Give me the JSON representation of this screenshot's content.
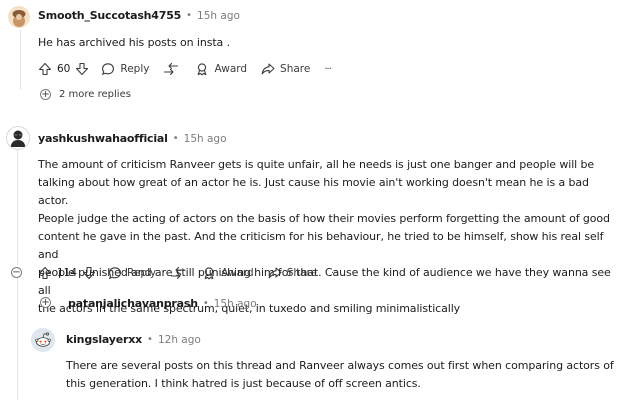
{
  "comments": [
    {
      "username": "Smooth_Succotash4755",
      "time": "15h ago",
      "body": [
        "He has archived his posts on insta ."
      ],
      "votes": "60",
      "actions": {
        "reply": "Reply",
        "award": "Award",
        "share": "Share",
        "more": "···"
      },
      "more_replies": "2 more replies"
    },
    {
      "username": "yashkushwahaofficial",
      "time": "15h ago",
      "body": [
        "The amount of criticism Ranveer gets is quite unfair, all he needs is just one banger and people will be",
        "talking about how great of an actor he is. Just cause his movie ain't working doesn't mean he is a bad actor.",
        "People judge the acting of actors on the basis of how their movies perform forgetting the amount of good",
        "content he gave in the past. And the criticism for his behaviour, he tried to be himself, show his real self and",
        "people punished and are still punishing him for that. Cause the kind of audience we have they wanna see all",
        "the actors in the same spectrum, quiet, in tuxedo and smiling minimalistically"
      ],
      "votes": "114",
      "actions": {
        "reply": "Reply",
        "award": "Award",
        "share": "Share",
        "more": "···"
      }
    },
    {
      "username": "patanjalichavanprash",
      "time": "15h ago"
    },
    {
      "username": "kingslayerxx",
      "time": "12h ago",
      "body": [
        "There are several posts on this thread and Ranveer always comes out first when comparing actors of",
        "this generation. I think hatred is just because of off screen antics."
      ]
    }
  ],
  "icons": {
    "upvote": "upvote-icon",
    "downvote": "downvote-icon",
    "reply": "comment-bubble-icon",
    "award": "award-icon",
    "share": "share-icon",
    "more": "ellipsis-icon",
    "expand": "plus-circle-icon",
    "collapse": "minus-circle-icon"
  },
  "colors": {
    "text": "#1c1c1c",
    "meta": "#7c7c7c",
    "thread_line": "#e3e6e8"
  }
}
